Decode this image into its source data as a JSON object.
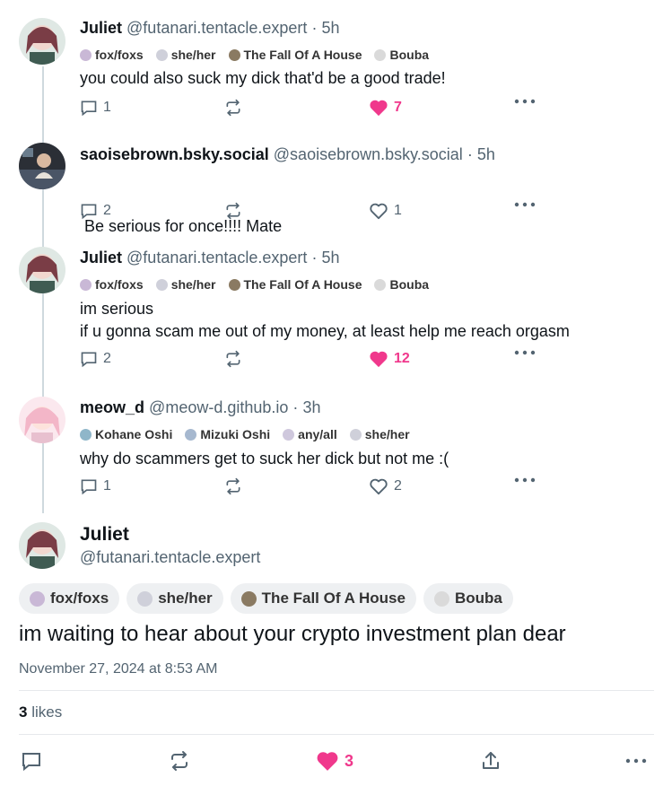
{
  "replies": [
    {
      "name": "Juliet",
      "handle": "@futanari.tentacle.expert",
      "dot": "·",
      "time": "5h",
      "badges": [
        "fox/foxs",
        "she/her",
        "The Fall Of A House",
        "Bouba"
      ],
      "lines": [
        "you could also suck my dick that'd be a good trade!"
      ],
      "reply_count": "1",
      "like_count": "7",
      "liked": true
    },
    {
      "name": "saoisebrown.bsky.social",
      "handle": "@saoisebrown.bsky.social",
      "dot": "·",
      "time": "5h",
      "badges": [],
      "lines": [
        " Be serious for once!!!! Mate"
      ],
      "reply_count": "2",
      "like_count": "1",
      "liked": false
    },
    {
      "name": "Juliet",
      "handle": "@futanari.tentacle.expert",
      "dot": "·",
      "time": "5h",
      "badges": [
        "fox/foxs",
        "she/her",
        "The Fall Of A House",
        "Bouba"
      ],
      "lines": [
        "im serious",
        "if u gonna scam me out of my money, at least help me reach orgasm"
      ],
      "reply_count": "2",
      "like_count": "12",
      "liked": true
    },
    {
      "name": "meow_d",
      "handle": "@meow-d.github.io",
      "dot": "·",
      "time": "3h",
      "badges": [
        "Kohane Oshi",
        "Mizuki Oshi",
        "any/all",
        "she/her"
      ],
      "lines": [
        "why do scammers get to suck her dick but not me :("
      ],
      "reply_count": "1",
      "like_count": "2",
      "liked": false
    }
  ],
  "main_post": {
    "name": "Juliet",
    "handle": "@futanari.tentacle.expert",
    "badges": [
      "fox/foxs",
      "she/her",
      "The Fall Of A House",
      "Bouba"
    ],
    "text": "im waiting to hear about your crypto investment plan dear",
    "date": "November 27, 2024 at 8:53 AM",
    "likes_count": "3",
    "likes_label": " likes",
    "like_count": "3"
  },
  "colors": {
    "like_pink": "#f0388c",
    "muted": "#536471",
    "thread_line": "#cfd9de"
  },
  "icons": [
    "reply-icon",
    "repost-icon",
    "heart-icon",
    "more-icon",
    "share-icon"
  ]
}
